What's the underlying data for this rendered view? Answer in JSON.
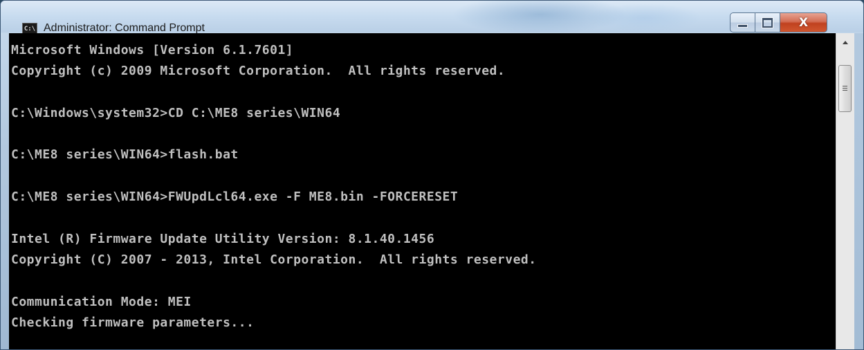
{
  "window": {
    "title": "Administrator: Command Prompt",
    "icon_label": "C:\\",
    "icon": "console-icon",
    "buttons": {
      "minimize": "minimize-icon",
      "maximize": "maximize-icon",
      "close": "close-icon",
      "close_glyph": "X"
    },
    "colors": {
      "console_background": "#000000",
      "console_text": "#c0c0c0",
      "close_button": "#c8462a"
    }
  },
  "console": {
    "lines": [
      "Microsoft Windows [Version 6.1.7601]",
      "Copyright (c) 2009 Microsoft Corporation.  All rights reserved.",
      "",
      "C:\\Windows\\system32>CD C:\\ME8 series\\WIN64",
      "",
      "C:\\ME8 series\\WIN64>flash.bat",
      "",
      "C:\\ME8 series\\WIN64>FWUpdLcl64.exe -F ME8.bin -FORCERESET",
      "",
      "Intel (R) Firmware Update Utility Version: 8.1.40.1456",
      "Copyright (C) 2007 - 2013, Intel Corporation.  All rights reserved.",
      "",
      "Communication Mode: MEI",
      "Checking firmware parameters..."
    ]
  }
}
